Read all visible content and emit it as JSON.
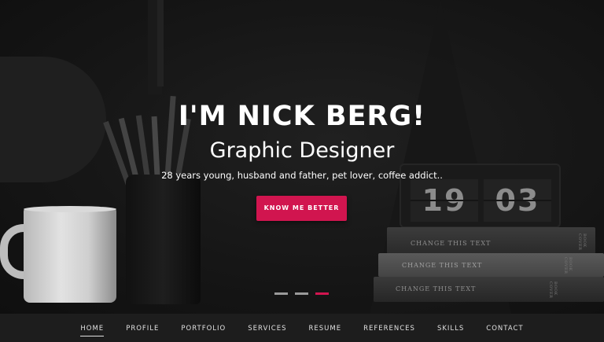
{
  "hero": {
    "title": "I'M NICK BERG!",
    "subtitle": "Graphic Designer",
    "tagline": "28 years young, husband and father, pet lover, coffee addict..",
    "cta_label": "KNOW ME BETTER",
    "accent_color": "#d1154f",
    "clock": {
      "hours": "19",
      "minutes": "03"
    },
    "books": [
      {
        "title": "CHANGE THIS TEXT",
        "spine": "BOOK COVER"
      },
      {
        "title": "CHANGE THIS TEXT",
        "spine": "BOOK COVER"
      },
      {
        "title": "CHANGE THIS TEXT",
        "spine": "BOOK COVER"
      }
    ],
    "slider": {
      "slide_count": 3,
      "active_index": 2
    }
  },
  "nav": {
    "items": [
      {
        "label": "HOME",
        "active": true
      },
      {
        "label": "PROFILE",
        "active": false
      },
      {
        "label": "PORTFOLIO",
        "active": false
      },
      {
        "label": "SERVICES",
        "active": false
      },
      {
        "label": "RESUME",
        "active": false
      },
      {
        "label": "REFERENCES",
        "active": false
      },
      {
        "label": "SKILLS",
        "active": false
      },
      {
        "label": "CONTACT",
        "active": false
      }
    ]
  }
}
